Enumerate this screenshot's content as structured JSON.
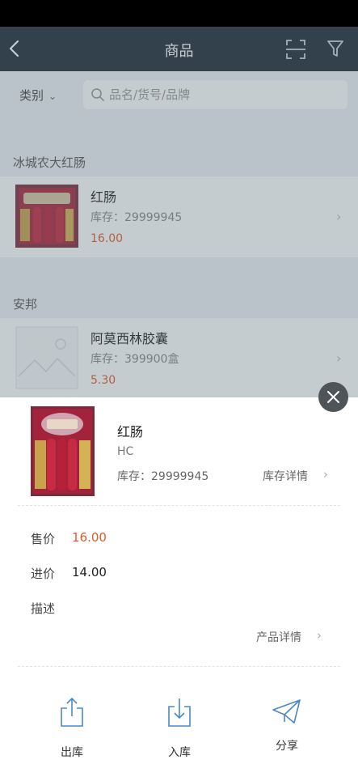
{
  "nav": {
    "title": "商品"
  },
  "search": {
    "category_label": "类别",
    "placeholder": "品名/货号/品牌"
  },
  "groups": [
    {
      "header": "冰城农大红肠",
      "item": {
        "name": "红肠",
        "stock": "库存：29999945",
        "price": "16.00"
      }
    },
    {
      "header": "安邦",
      "item": {
        "name": "阿莫西林胶囊",
        "stock": "库存：399900盒",
        "price": "5.30"
      }
    }
  ],
  "detail": {
    "name": "红肠",
    "code": "HC",
    "stock": "库存：29999945",
    "stock_detail_label": "库存详情",
    "sell_price_label": "售价",
    "sell_price": "16.00",
    "buy_price_label": "进价",
    "buy_price": "14.00",
    "description_label": "描述",
    "product_detail_label": "产品详情",
    "price_color": "#e05a2a"
  },
  "actions": {
    "outbound": "出库",
    "inbound": "入库",
    "share": "分享"
  }
}
